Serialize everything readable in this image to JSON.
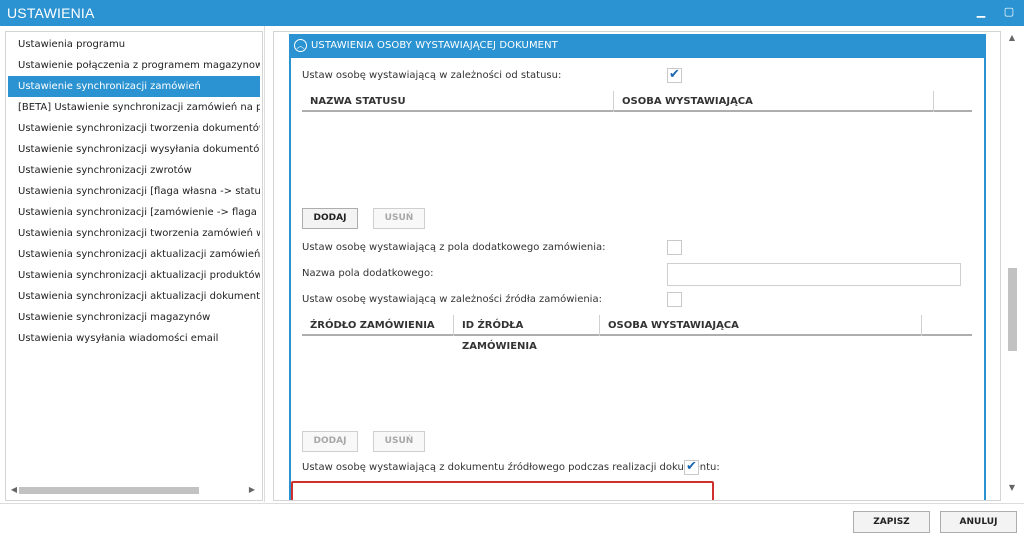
{
  "window": {
    "title": "USTAWIENIA"
  },
  "sidebar": {
    "items": [
      {
        "label": "Ustawienia programu"
      },
      {
        "label": "Ustawienie połączenia z programem magazynowym"
      },
      {
        "label": "Ustawienie synchronizacji zamówień"
      },
      {
        "label": "[BETA] Ustawienie synchronizacji zamówień na podsta"
      },
      {
        "label": "Ustawienie synchronizacji tworzenia dokumentów PW"
      },
      {
        "label": "Ustawienie synchronizacji wysyłania dokumentów"
      },
      {
        "label": "Ustawienie synchronizacji zwrotów"
      },
      {
        "label": "Ustawienia synchronizacji [flaga własna -> status]"
      },
      {
        "label": "Ustawienia synchronizacji [zamówienie -> flaga własn"
      },
      {
        "label": "Ustawienia synchronizacji tworzenia zamówień w Base"
      },
      {
        "label": "Ustawienia synchronizacji aktualizacji zamówień w Bas"
      },
      {
        "label": "Ustawienia synchronizacji aktualizacji produktów w Ba"
      },
      {
        "label": "Ustawienia synchronizacji aktualizacji dokumentów"
      },
      {
        "label": "Ustawienie synchronizacji magazynów"
      },
      {
        "label": "Ustawienia wysyłania wiadomości email"
      }
    ],
    "active_index": 2
  },
  "section": {
    "title": "USTAWIENIA OSOBY WYSTAWIAJĄCEJ DOKUMENT",
    "by_status_label": "Ustaw osobę wystawiającą w zależności od statusu:",
    "status_grid": {
      "columns": [
        "NAZWA STATUSU",
        "OSOBA WYSTAWIAJĄCA",
        ""
      ]
    },
    "add_label": "DODAJ",
    "remove_label": "USUŃ",
    "extra_field_label": "Ustaw osobę wystawiającą z pola dodatkowego zamówienia:",
    "extra_field_name_label": "Nazwa pola dodatkowego:",
    "extra_field_name_value": "",
    "by_source_label": "Ustaw osobę wystawiającą w zależności źródła zamówienia:",
    "source_grid": {
      "columns": [
        "ŹRÓDŁO ZAMÓWIENIA",
        "ID ŹRÓDŁA ZAMÓWIENIA",
        "OSOBA WYSTAWIAJĄCA",
        ""
      ]
    },
    "add2_label": "DODAJ",
    "remove2_label": "USUŃ",
    "from_source_doc_label": "Ustaw osobę wystawiającą z dokumentu źródłowego podczas realizacji dokumentu:"
  },
  "footer": {
    "save_label": "ZAPISZ",
    "cancel_label": "ANULUJ"
  },
  "colors": {
    "accent": "#2b93d1",
    "highlight": "#d0312d",
    "check": "#1a66b3"
  }
}
